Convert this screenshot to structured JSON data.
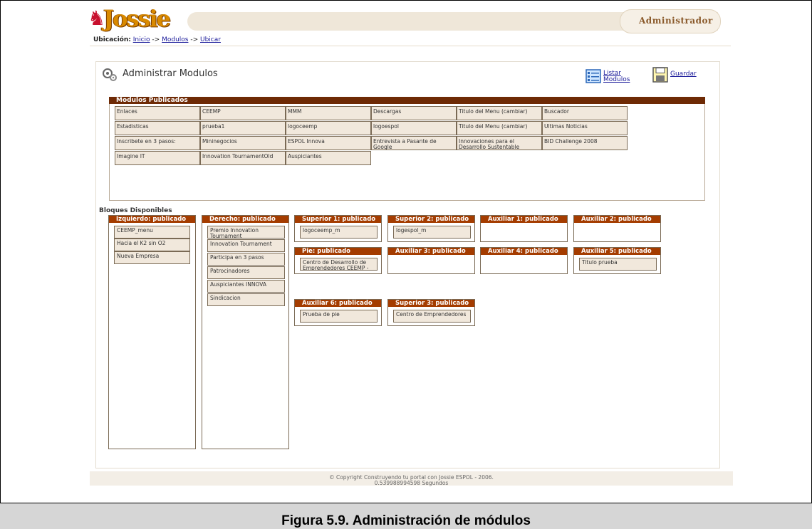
{
  "header": {
    "logo_text": "Jossie",
    "badge": "Administrador"
  },
  "breadcrumb": {
    "label": "Ubicación:",
    "items": [
      "Inicio",
      "Modulos",
      "Ubicar"
    ],
    "sep": " -> "
  },
  "page": {
    "title": "Administrar Modulos",
    "list_action": "Listar Modulos",
    "save_action": "Guardar"
  },
  "publicados": {
    "title": "Modulos Publicados",
    "rows": [
      [
        "Enlaces",
        "CEEMP",
        "MMM",
        "Descargas",
        "Titulo del Menu (cambiar)",
        "Buscador"
      ],
      [
        "Estadisticas",
        "prueba1",
        "logoceemp",
        "logoespol",
        "Titulo del Menu (cambiar)",
        "Ultimas Noticias"
      ],
      [
        "Inscribete en 3 pasos:",
        "Mininegocios",
        "ESPOL Innova",
        "Entrevista a Pasante de Google",
        "Innovaciones para el Desarrollo Sustentable",
        "BID Challenge 2008"
      ],
      [
        "Imagine IT",
        "Innovation TournamentOld",
        "Auspiciantes"
      ]
    ]
  },
  "bloques": {
    "title": "Bloques Disponibles",
    "izquierdo": {
      "title": "Izquierdo: publicado",
      "items": [
        "CEEMP_menu",
        "Hacia el K2 sin O2",
        "Nueva Empresa"
      ]
    },
    "derecho": {
      "title": "Derecho: publicado",
      "items": [
        "Premio Innovation Tournament",
        "Innovation Tournament",
        "Participa en 3 pasos",
        "Patrocinadores",
        "Auspiciantes INNOVA",
        "Sindicacion"
      ]
    },
    "superior1": {
      "title": "Superior 1: publicado",
      "items": [
        "logoceemp_m"
      ]
    },
    "superior2": {
      "title": "Superior 2: publicado",
      "items": [
        "logespol_m"
      ]
    },
    "auxiliar1": {
      "title": "Auxiliar 1: publicado",
      "items": []
    },
    "auxiliar2": {
      "title": "Auxiliar 2: publicado",
      "items": []
    },
    "pie": {
      "title": "Pie: publicado",
      "items": [
        "Centro de Desarrollo de Emprendedores CEEMP - ESPOL"
      ]
    },
    "auxiliar3": {
      "title": "Auxiliar 3: publicado",
      "items": []
    },
    "auxiliar4": {
      "title": "Auxiliar 4: publicado",
      "items": []
    },
    "auxiliar5": {
      "title": "Auxiliar 5: publicado",
      "items": [
        "Titulo prueba"
      ]
    },
    "auxiliar6": {
      "title": "Auxiliar 6: publicado",
      "items": [
        "Prueba de pie"
      ]
    },
    "superior3": {
      "title": "Superior 3: publicado",
      "items": [
        "Centro de Emprendedores"
      ]
    }
  },
  "footer": {
    "line1": "© Copyright Construyendo tu portal con Jossie ESPOL - 2006.",
    "line2": "0.539988994598 Segundos"
  },
  "caption": "Figura 5.9. Administración de módulos"
}
